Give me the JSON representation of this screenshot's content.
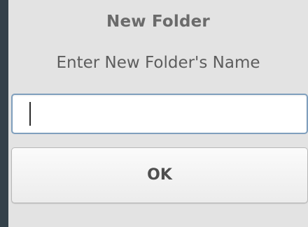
{
  "dialog": {
    "title": "New Folder",
    "message": "Enter New Folder's Name",
    "input": {
      "value": "",
      "placeholder": ""
    },
    "ok_label": "OK"
  }
}
